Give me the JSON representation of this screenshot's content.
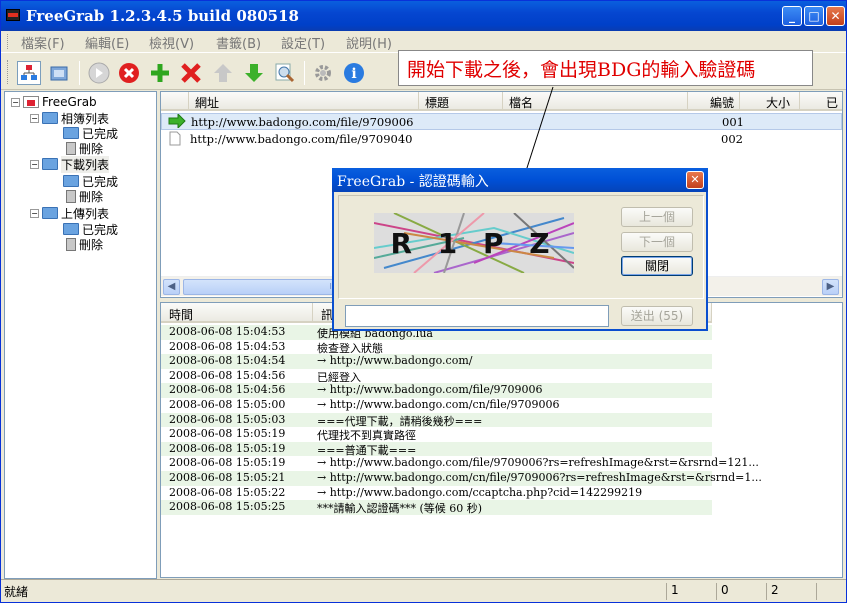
{
  "app": {
    "title": "FreeGrab 1.2.3.4.5 build 080518",
    "title_buttons": [
      "_",
      "□",
      "✕"
    ]
  },
  "menu": [
    {
      "label": "檔案(F)"
    },
    {
      "label": "編輯(E)"
    },
    {
      "label": "檢視(V)"
    },
    {
      "label": "書籤(B)"
    },
    {
      "label": "設定(T)"
    },
    {
      "label": "說明(H)"
    }
  ],
  "toolbar": {
    "icons": [
      "tree-view-icon",
      "window-icon",
      "start-icon",
      "stop-icon",
      "add-icon",
      "delete-icon",
      "move-up-icon",
      "move-down-icon",
      "search-icon",
      "settings-icon",
      "info-icon"
    ]
  },
  "annotation": "開始下載之後，會出現BDG的輸入驗證碼",
  "tree": {
    "root": "FreeGrab",
    "groups": [
      {
        "label": "相簿列表",
        "children": [
          "已完成",
          "刪除"
        ]
      },
      {
        "label": "下載列表",
        "children": [
          "已完成",
          "刪除"
        ]
      },
      {
        "label": "上傳列表",
        "children": [
          "已完成",
          "刪除"
        ]
      }
    ]
  },
  "list": {
    "columns": [
      "網址",
      "標題",
      "檔名",
      "編號",
      "大小",
      "已"
    ],
    "rows": [
      {
        "url": "http://www.badongo.com/file/9709006",
        "num": "001"
      },
      {
        "url": "http://www.badongo.com/file/9709040",
        "num": "002"
      }
    ],
    "scroll_thumb": "III"
  },
  "log": {
    "columns": [
      "時間",
      "訊"
    ],
    "rows": [
      {
        "time": "2008-06-08 15:04:53",
        "msg": "使用模組 badongo.lua"
      },
      {
        "time": "2008-06-08 15:04:53",
        "msg": "檢查登入狀態"
      },
      {
        "time": "2008-06-08 15:04:54",
        "msg": "→ http://www.badongo.com/"
      },
      {
        "time": "2008-06-08 15:04:56",
        "msg": "已經登入"
      },
      {
        "time": "2008-06-08 15:04:56",
        "msg": "→ http://www.badongo.com/file/9709006"
      },
      {
        "time": "2008-06-08 15:05:00",
        "msg": "→ http://www.badongo.com/cn/file/9709006"
      },
      {
        "time": "2008-06-08 15:05:03",
        "msg": "===代理下載，請稍後幾秒==="
      },
      {
        "time": "2008-06-08 15:05:19",
        "msg": "代理找不到真實路徑"
      },
      {
        "time": "2008-06-08 15:05:19",
        "msg": "===普通下載==="
      },
      {
        "time": "2008-06-08 15:05:19",
        "msg": "→ http://www.badongo.com/file/9709006?rs=refreshImage&rst=&rsrnd=121..."
      },
      {
        "time": "2008-06-08 15:05:21",
        "msg": "→ http://www.badongo.com/cn/file/9709006?rs=refreshImage&rst=&rsrnd=1..."
      },
      {
        "time": "2008-06-08 15:05:22",
        "msg": "→ http://www.badongo.com/ccaptcha.php?cid=142299219"
      },
      {
        "time": "2008-06-08 15:05:25",
        "msg": "***請輸入認證碼*** (等候 60 秒)"
      }
    ]
  },
  "dialog": {
    "title": "FreeGrab - 認證碼輸入",
    "captcha_text": "R 1 P Z",
    "prev_label": "上一個",
    "next_label": "下一個",
    "close_label": "關閉",
    "send_label": "送出 (55)",
    "code_value": ""
  },
  "status": {
    "text": "就緒",
    "cells": [
      "1",
      "0",
      "2"
    ]
  }
}
